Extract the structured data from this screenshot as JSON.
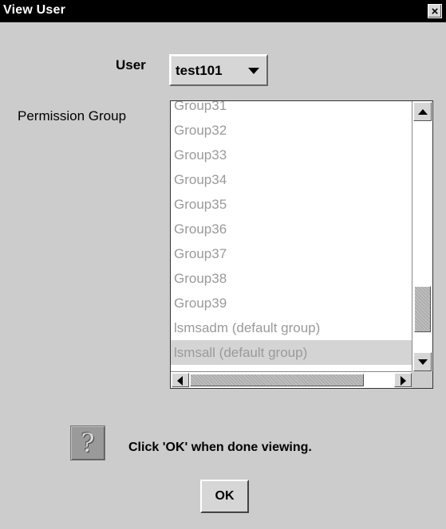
{
  "window": {
    "title": "View User",
    "close_label": "×"
  },
  "form": {
    "user_label": "User",
    "user_value": "test101",
    "permission_label": "Permission Group",
    "groups": [
      "Group31",
      "Group32",
      "Group33",
      "Group34",
      "Group35",
      "Group36",
      "Group37",
      "Group38",
      "Group39",
      "lsmsadm (default group)",
      "lsmsall (default group)"
    ],
    "selected_group": "lsmsall (default group)"
  },
  "footer": {
    "help_glyph": "?",
    "message": "Click 'OK' when done viewing.",
    "ok_label": "OK"
  },
  "colors": {
    "window_background": "#cccccc",
    "titlebar_background": "#000000",
    "disabled_text": "#9a9a9a",
    "list_selection": "#d4d4d4"
  },
  "icons": {
    "close": "close-icon",
    "dropdown": "chevron-down-icon",
    "help": "question-mark-icon"
  }
}
